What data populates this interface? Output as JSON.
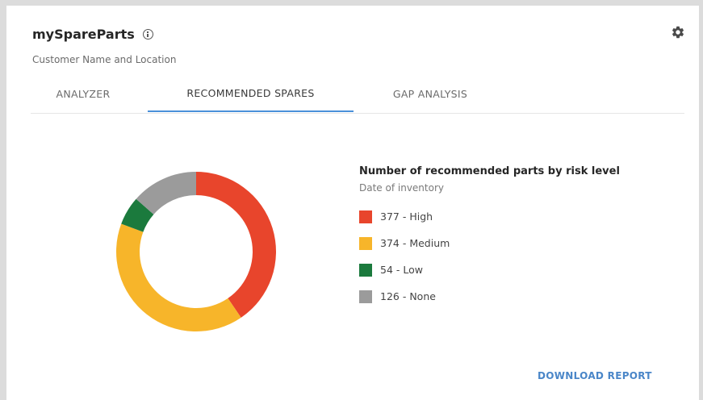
{
  "header": {
    "title": "mySpareParts",
    "subtitle": "Customer Name and Location"
  },
  "tabs": [
    {
      "label": "ANALYZER",
      "active": false
    },
    {
      "label": "RECOMMENDED SPARES",
      "active": true
    },
    {
      "label": "GAP ANALYSIS",
      "active": false
    }
  ],
  "legend": {
    "title": "Number of recommended parts by risk level",
    "subtitle": "Date of inventory",
    "items": [
      {
        "text": "377 - High",
        "color": "#e8452c"
      },
      {
        "text": "374 - Medium",
        "color": "#f7b52a"
      },
      {
        "text": "54 - Low",
        "color": "#1b7a3d"
      },
      {
        "text": "126 - None",
        "color": "#9b9b9b"
      }
    ]
  },
  "chart_data": {
    "type": "pie",
    "variant": "donut",
    "categories": [
      "High",
      "Medium",
      "Low",
      "None"
    ],
    "values": [
      377,
      374,
      54,
      126
    ],
    "colors": [
      "#e8452c",
      "#f7b52a",
      "#1b7a3d",
      "#9b9b9b"
    ],
    "title": "Number of recommended parts by risk level",
    "subtitle": "Date of inventory",
    "legend": "right"
  },
  "actions": {
    "download_label": "DOWNLOAD REPORT"
  },
  "icons": {
    "info": "info-icon",
    "settings": "gear-icon"
  }
}
